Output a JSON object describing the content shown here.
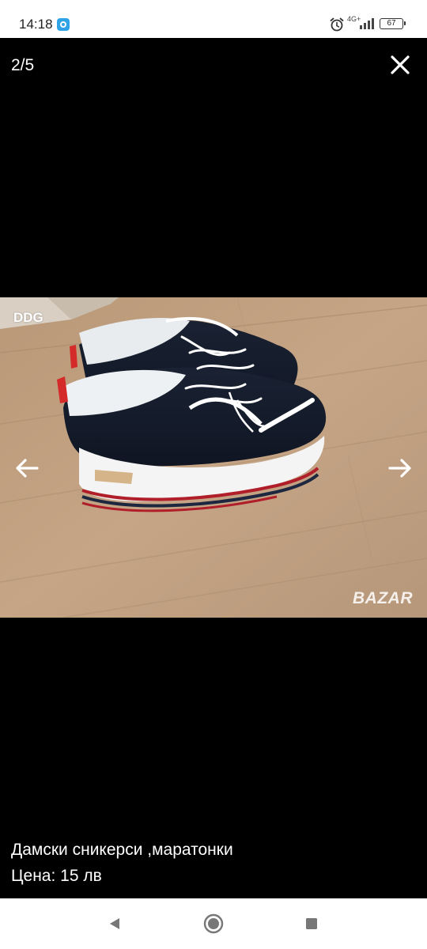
{
  "status_bar": {
    "time": "14:18",
    "network": "4G+",
    "battery": "67"
  },
  "gallery": {
    "counter": "2/5",
    "image_label": "DDG",
    "watermark": "BAZAR"
  },
  "description": {
    "title": "Дамски сникерси ,маратонки",
    "price": "Цена: 15 лв"
  },
  "icons": {
    "close": "close-icon",
    "prev": "arrow-left-icon",
    "next": "arrow-right-icon",
    "back": "back-triangle-icon",
    "home": "home-circle-icon",
    "recent": "recent-square-icon"
  }
}
